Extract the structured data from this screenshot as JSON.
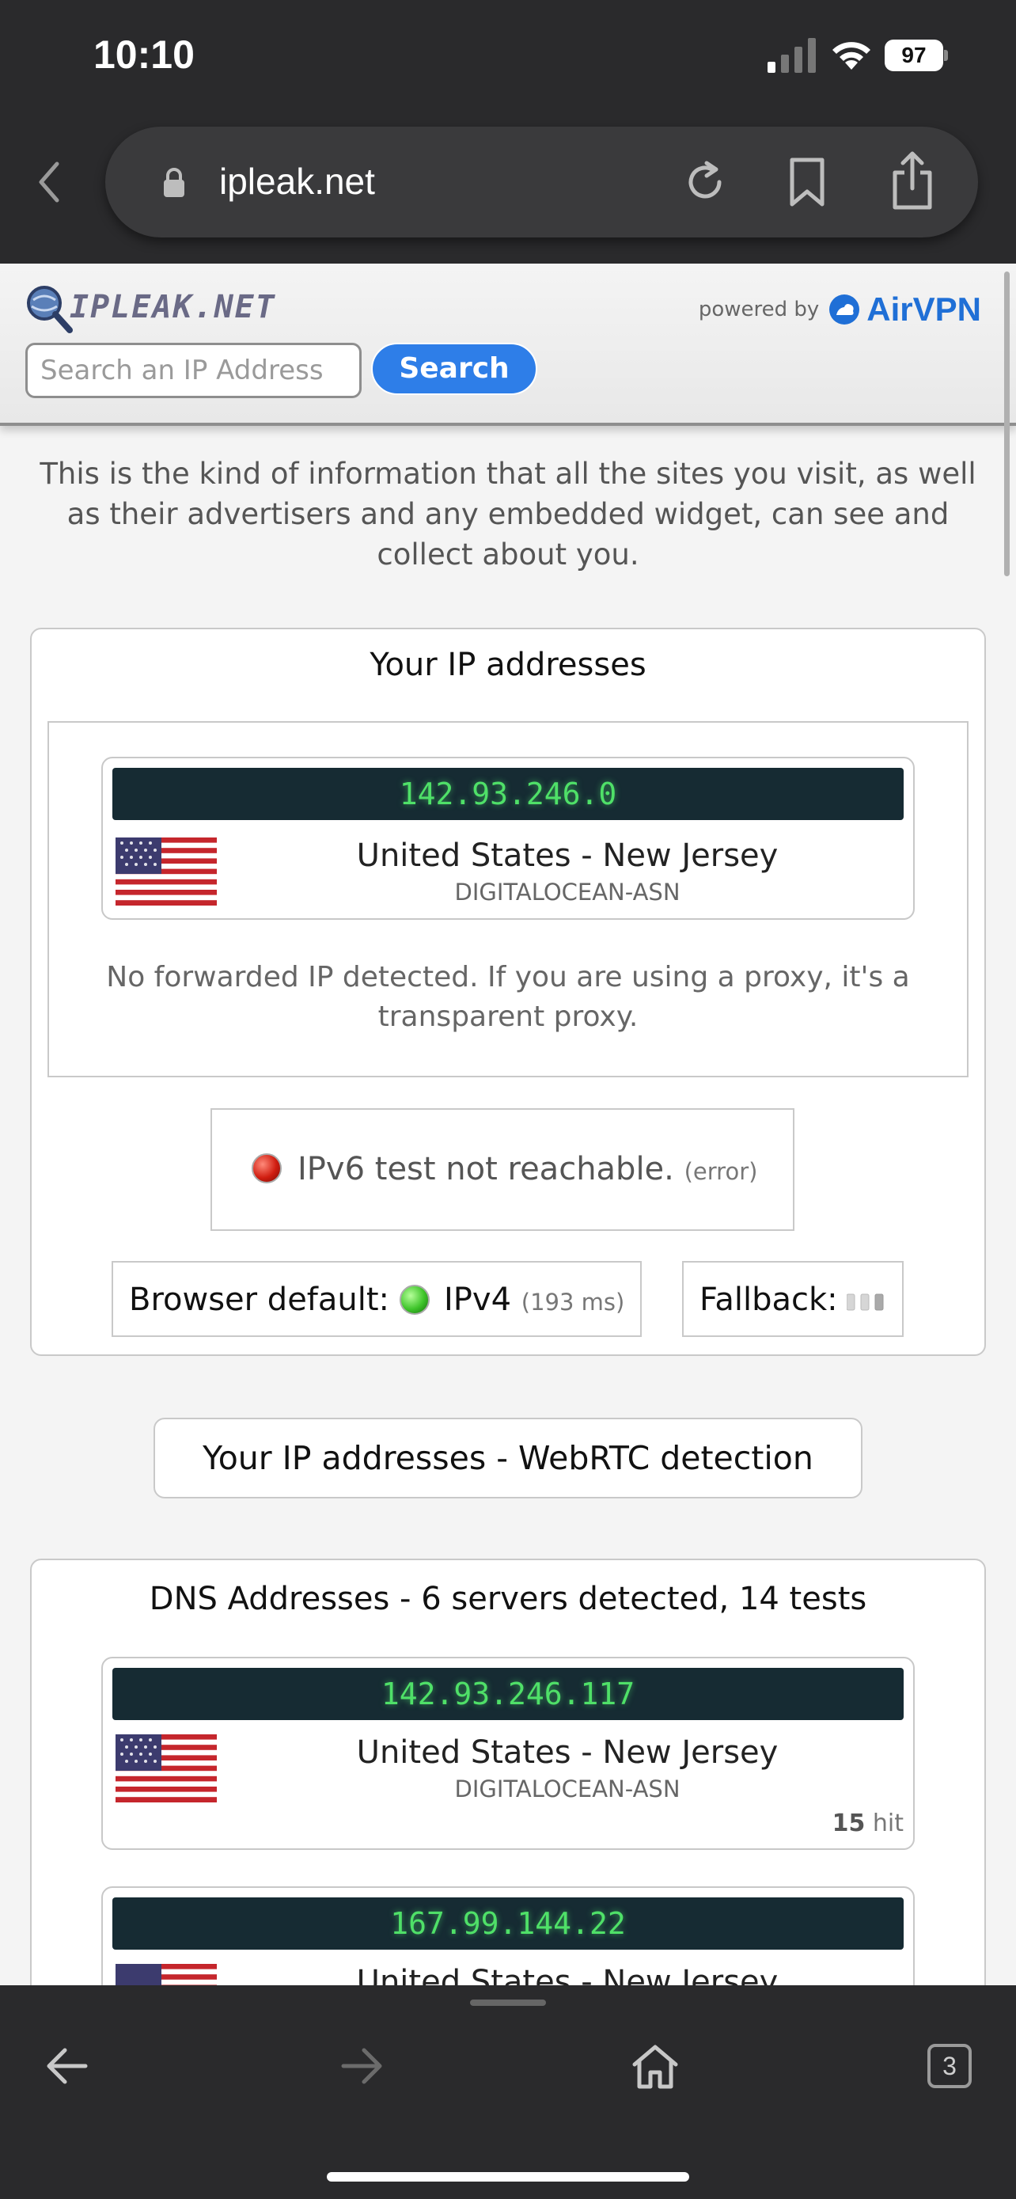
{
  "status_bar": {
    "time": "10:10",
    "battery": "97"
  },
  "browser": {
    "url": "ipleak.net",
    "tab_count": "3"
  },
  "site": {
    "logo_text": "IPLEAK.NET",
    "powered_by": "powered by",
    "partner": "AirVPN",
    "search_placeholder": "Search an IP Address",
    "search_button": "Search",
    "intro": "This is the kind of information that all the sites you visit, as well as their advertisers and any embedded widget, can see and collect about you."
  },
  "ip_section": {
    "title": "Your IP addresses",
    "ip": "142.93.246.0",
    "location": "United States - New Jersey",
    "org": "DIGITALOCEAN-ASN",
    "no_forwarded": "No forwarded IP detected. If you are using a proxy, it's a transparent proxy.",
    "ipv6_text": "IPv6 test not reachable.",
    "ipv6_status": "(error)",
    "browser_default_label": "Browser default:",
    "browser_default_value": "IPv4",
    "browser_default_latency": "(193 ms)",
    "fallback_label": "Fallback:"
  },
  "webrtc": {
    "label": "Your IP addresses - WebRTC detection"
  },
  "dns": {
    "title": "DNS Addresses - 6 servers detected, 14 tests",
    "servers": [
      {
        "ip": "142.93.246.117",
        "location": "United States - New Jersey",
        "org": "DIGITALOCEAN-ASN",
        "hits": "15",
        "hit_label": "hit"
      },
      {
        "ip": "167.99.144.22",
        "location": "United States - New Jersey"
      }
    ]
  },
  "colors": {
    "accent": "#2e7ee8",
    "ip_bar_bg": "#162b33",
    "ip_text": "#4fe068",
    "error_dot": "#d01d10",
    "ok_dot": "#3ec42a"
  }
}
